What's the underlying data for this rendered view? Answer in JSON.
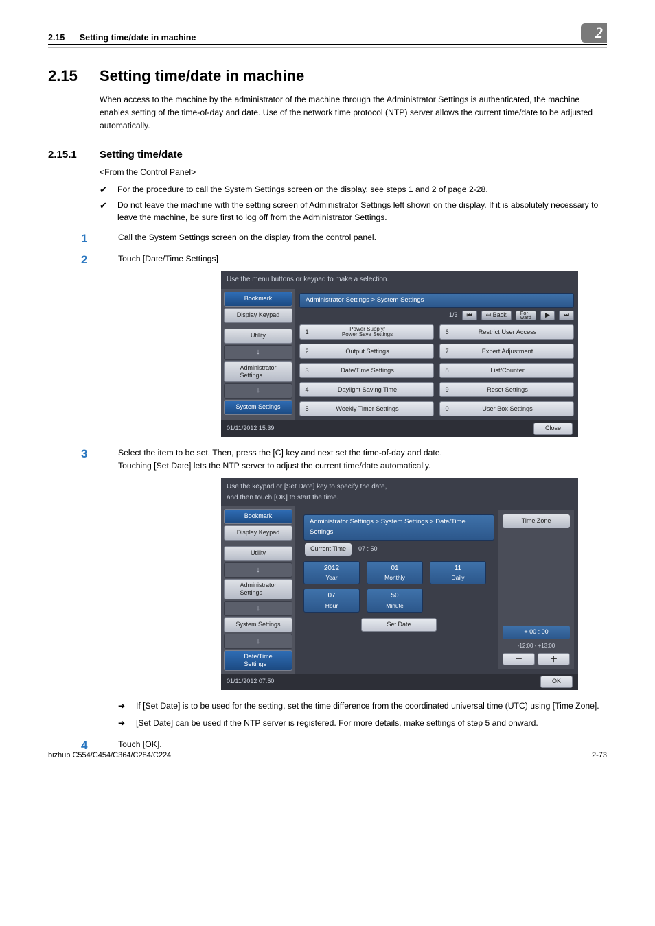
{
  "header": {
    "section_num": "2.15",
    "section_title": "Setting time/date in machine",
    "chapter_num": "2"
  },
  "h1": {
    "num": "2.15",
    "title": "Setting time/date in machine"
  },
  "intro": "When access to the machine by the administrator of the machine through the Administrator Settings is authenticated, the machine enables setting of the time-of-day and date. Use of the network time protocol (NTP) server allows the current time/date to be adjusted automatically.",
  "h2": {
    "num": "2.15.1",
    "title": "Setting time/date"
  },
  "from_cp": "<From the Control Panel>",
  "check1": "For the procedure to call the System Settings screen on the display, see steps 1 and 2 of page 2-28.",
  "check2": "Do not leave the machine with the setting screen of Administrator Settings left shown on the display. If it is absolutely necessary to leave the machine, be sure first to log off from the Administrator Settings.",
  "step1": {
    "n": "1",
    "t": "Call the System Settings screen on the display from the control panel."
  },
  "step2": {
    "n": "2",
    "t": "Touch [Date/Time Settings]"
  },
  "step3": {
    "n": "3",
    "t": "Select the item to be set. Then, press the [C] key and next set the time-of-day and date.",
    "t2": "Touching [Set Date] lets the NTP server to adjust the current time/date automatically."
  },
  "step4": {
    "n": "4",
    "t": "Touch [OK]."
  },
  "arrow1": "If [Set Date] is to be used for the setting, set the time difference from the coordinated universal time (UTC) using [Time Zone].",
  "arrow2": "[Set Date] can be used if the NTP server is registered. For more details, make settings of step 5 and onward.",
  "panel1": {
    "instr": "Use the menu buttons or keypad to make a selection.",
    "crumb": "Administrator Settings > System Settings",
    "page": "1/3",
    "back": "↤ Back",
    "fwd": "For-\nward",
    "left": {
      "bookmark": "Bookmark",
      "display_keypad": "Display Keypad",
      "utility": "Utility",
      "admin": "Administrator\nSettings",
      "sys": "System Settings"
    },
    "opts": [
      {
        "n": "1",
        "t": "Power Supply/\nPower Save Settings"
      },
      {
        "n": "6",
        "t": "Restrict User Access"
      },
      {
        "n": "2",
        "t": "Output Settings"
      },
      {
        "n": "7",
        "t": "Expert Adjustment"
      },
      {
        "n": "3",
        "t": "Date/Time Settings"
      },
      {
        "n": "8",
        "t": "List/Counter"
      },
      {
        "n": "4",
        "t": "Daylight Saving Time"
      },
      {
        "n": "9",
        "t": "Reset Settings"
      },
      {
        "n": "5",
        "t": "Weekly Timer Settings"
      },
      {
        "n": "0",
        "t": "User Box Settings"
      }
    ],
    "status_dt": "01/11/2012    15:39",
    "close": "Close"
  },
  "panel2": {
    "instr": "Use the keypad or [Set Date] key to specify the date,\nand then touch [OK] to start the time.",
    "crumb": "Administrator Settings > System Settings > Date/Time Settings",
    "left": {
      "bookmark": "Bookmark",
      "display_keypad": "Display Keypad",
      "utility": "Utility",
      "admin": "Administrator\nSettings",
      "sys": "System Settings",
      "dt": "Date/Time\nSettings"
    },
    "current_time_label": "Current Time",
    "current_time_value": "07 : 50",
    "fields": {
      "year": {
        "v": "2012",
        "l": "Year"
      },
      "month": {
        "v": "01",
        "l": "Monthly"
      },
      "day": {
        "v": "11",
        "l": "Daily"
      },
      "hour": {
        "v": "07",
        "l": "Hour"
      },
      "minute": {
        "v": "50",
        "l": "Minute"
      }
    },
    "set_date": "Set Date",
    "tz": {
      "head": "Time Zone",
      "value": "+ 00 : 00",
      "range": "-12:00  -  +13:00",
      "minus": "－",
      "plus": "＋"
    },
    "status_dt": "01/11/2012    07:50",
    "ok": "OK"
  },
  "footer": {
    "left": "bizhub C554/C454/C364/C284/C224",
    "right": "2-73"
  }
}
